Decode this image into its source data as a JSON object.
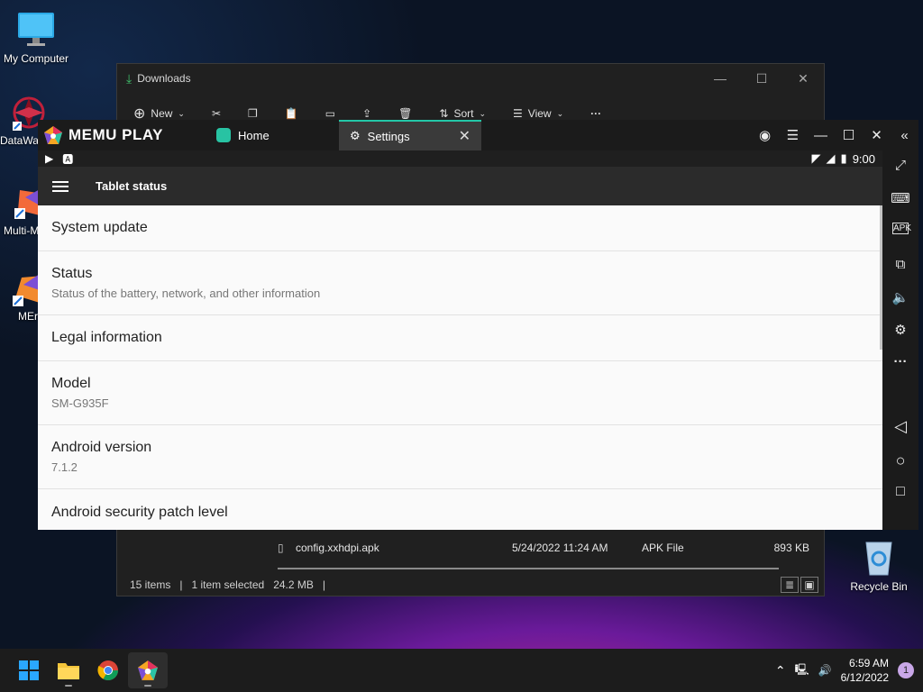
{
  "desktop": {
    "icons": [
      {
        "label": "My Computer"
      },
      {
        "label": "DataWa"
      },
      {
        "label": "Multi-M"
      },
      {
        "label": "MEr"
      },
      {
        "label": "Recycle Bin"
      }
    ]
  },
  "explorer": {
    "title": "Downloads",
    "toolbar": {
      "new_label": "New",
      "sort_label": "Sort",
      "view_label": "View"
    },
    "file": {
      "name": "config.xxhdpi.apk",
      "date": "5/24/2022 11:24 AM",
      "type": "APK File",
      "size": "893 KB"
    },
    "status": {
      "items": "15 items",
      "selected": "1 item selected",
      "size": "24.2 MB"
    }
  },
  "memu": {
    "brand": "MEMU PLAY",
    "tabs": [
      {
        "label": "Home"
      },
      {
        "label": "Settings"
      }
    ],
    "android": {
      "time": "9:00",
      "appbar_title": "Tablet status",
      "items": [
        {
          "title": "System update",
          "subtitle": ""
        },
        {
          "title": "Status",
          "subtitle": "Status of the battery, network, and other information"
        },
        {
          "title": "Legal information",
          "subtitle": ""
        },
        {
          "title": "Model",
          "subtitle": "SM-G935F"
        },
        {
          "title": "Android version",
          "subtitle": "7.1.2"
        },
        {
          "title": "Android security patch level",
          "subtitle": ""
        }
      ]
    }
  },
  "taskbar": {
    "time": "6:59 AM",
    "date": "6/12/2022",
    "notifications": "1"
  }
}
